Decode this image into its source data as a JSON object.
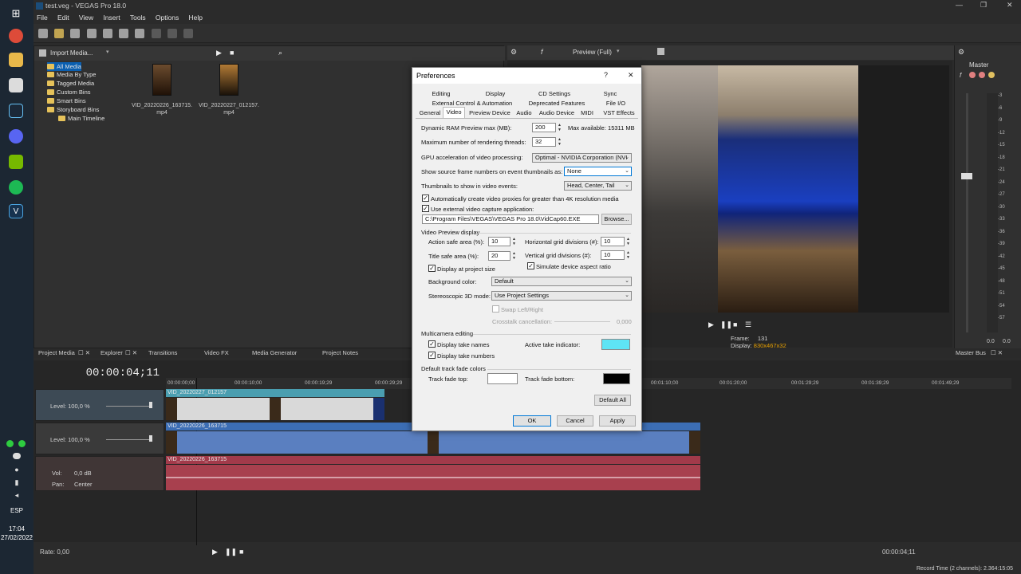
{
  "window": {
    "title": "test.veg - VEGAS Pro 18.0"
  },
  "menu": [
    "File",
    "Edit",
    "View",
    "Insert",
    "Tools",
    "Options",
    "Help"
  ],
  "taskbar": {
    "lang": "ESP",
    "time": "17:04",
    "date": "27/02/2022"
  },
  "media": {
    "toolbar_label": "Import Media...",
    "tree": [
      "All Media",
      "Media By Type",
      "Tagged Media",
      "Custom Bins",
      "Smart Bins",
      "Storyboard Bins",
      "Main Timeline"
    ],
    "files": [
      {
        "name": "VID_20220226_163715.\nmp4"
      },
      {
        "name": "VID_20220227_012157.\nmp4"
      }
    ]
  },
  "preview": {
    "mode": "Preview (Full)",
    "frame_label": "Frame:",
    "frame_value": "131",
    "display_label": "Display:",
    "display_value": "830x467x32"
  },
  "master": {
    "title": "Master",
    "meter_ticks": [
      "-3",
      "-6",
      "-9",
      "-12",
      "-15",
      "-18",
      "-21",
      "-24",
      "-27",
      "-30",
      "-33",
      "-36",
      "-39",
      "-42",
      "-45",
      "-48",
      "-51",
      "-54",
      "-57"
    ],
    "readout_left": "0.0",
    "readout_right": "0.0"
  },
  "tabs": [
    "Project Media",
    "Explorer",
    "Transitions",
    "Video FX",
    "Media Generator",
    "Project Notes"
  ],
  "master_bus_tab": "Master Bus",
  "timeline": {
    "timecode": "00:00:04;11",
    "ruler": [
      "00:00:00;00",
      "00:00:10;00",
      "00:00:19;29",
      "00:00:29;29",
      "00:01:20;00",
      "00:01:29;29",
      "00:01:39;29",
      "00:01:49;29",
      "00:01:10;00"
    ],
    "tracks": [
      {
        "level": "Level: 100,0 %",
        "clip": "VID_20220227_012157"
      },
      {
        "level": "Level: 100,0 %",
        "clip": "VID_20220226_163715"
      },
      {
        "vol_label": "Vol:",
        "vol_value": "0,0 dB",
        "pan_label": "Pan:",
        "pan_value": "Center",
        "clip": "VID_20220226_163715"
      }
    ],
    "rate": "Rate: 0,00",
    "end_timecode": "00:00:04;11",
    "status": "Record Time (2 channels): 2.364:15:05"
  },
  "dialog": {
    "title": "Preferences",
    "help": "?",
    "close": "✕",
    "tabs_row1": [
      "Editing",
      "Display",
      "CD Settings",
      "Sync"
    ],
    "tabs_row2": [
      "External Control & Automation",
      "Deprecated Features",
      "File I/O"
    ],
    "tabs_row3": [
      "General",
      "Video",
      "Preview Device",
      "Audio",
      "Audio Device",
      "MIDI",
      "VST Effects"
    ],
    "ram_label": "Dynamic RAM Preview max (MB):",
    "ram_value": "200",
    "ram_max": "Max available: 15311 MB",
    "threads_label": "Maximum number of rendering threads:",
    "threads_value": "32",
    "gpu_label": "GPU acceleration of video processing:",
    "gpu_value": "Optimal - NVIDIA Corporation (NVI",
    "frame_numbers_label": "Show source frame numbers on event thumbnails as:",
    "frame_numbers_value": "None",
    "thumbs_label": "Thumbnails to show in video events:",
    "thumbs_value": "Head, Center, Tail",
    "proxies_label": "Automatically create video proxies for greater than 4K resolution media",
    "capture_label": "Use external video capture application:",
    "capture_path": "C:\\Program Files\\VEGAS\\VEGAS Pro 18.0\\VidCap60.EXE",
    "browse": "Browse...",
    "preview_section": "Video Preview display",
    "action_safe_label": "Action safe area (%):",
    "action_safe_value": "10",
    "title_safe_label": "Title safe area (%):",
    "title_safe_value": "20",
    "hgrid_label": "Horizontal grid divisions (#):",
    "hgrid_value": "10",
    "vgrid_label": "Vertical grid divisions (#):",
    "vgrid_value": "10",
    "project_size_label": "Display at project size",
    "aspect_label": "Simulate device aspect ratio",
    "bg_label": "Background color:",
    "bg_value": "Default",
    "stereo_label": "Stereoscopic 3D mode:",
    "stereo_value": "Use Project Settings",
    "swap_label": "Swap Left/Right",
    "crosstalk_label": "Crosstalk cancellation:",
    "crosstalk_value": "0,000",
    "multicam_section": "Multicamera editing",
    "take_names_label": "Display take names",
    "take_numbers_label": "Display take numbers",
    "active_take_label": "Active take indicator:",
    "active_take_color": "#5ee4f5",
    "fade_section": "Default track fade colors",
    "fade_top_label": "Track fade top:",
    "fade_top_color": "#ffffff",
    "fade_bottom_label": "Track fade bottom:",
    "fade_bottom_color": "#000000",
    "default_all": "Default All",
    "ok": "OK",
    "cancel": "Cancel",
    "apply": "Apply"
  }
}
